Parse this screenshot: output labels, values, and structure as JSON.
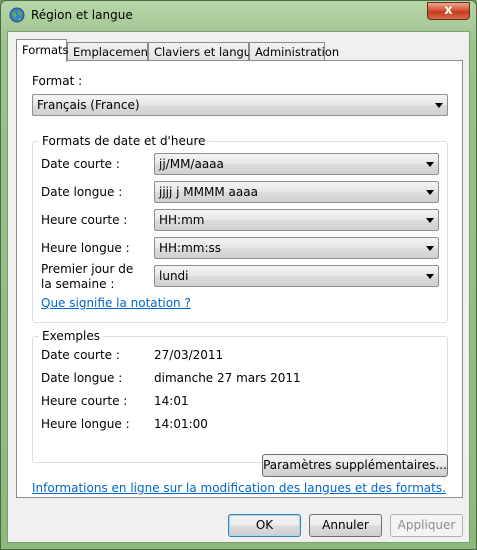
{
  "window": {
    "title": "Région et langue",
    "close_glyph": "x"
  },
  "tabs": [
    {
      "label": "Formats",
      "active": true
    },
    {
      "label": "Emplacement",
      "active": false
    },
    {
      "label": "Claviers et langues",
      "active": false
    },
    {
      "label": "Administration",
      "active": false
    }
  ],
  "format": {
    "label": "Format :",
    "value": "Français (France)"
  },
  "date_time_group": {
    "title": "Formats de date et d'heure",
    "rows": [
      {
        "label": "Date courte :",
        "value": "jj/MM/aaaa"
      },
      {
        "label": "Date longue :",
        "value": "jjjj j MMMM aaaa"
      },
      {
        "label": "Heure courte :",
        "value": "HH:mm"
      },
      {
        "label": "Heure longue :",
        "value": "HH:mm:ss"
      }
    ],
    "first_day_label_line1": "Premier jour de",
    "first_day_label_line2": "la semaine :",
    "first_day_value": "lundi",
    "notation_link": "Que signifie la notation ?"
  },
  "examples_group": {
    "title": "Exemples",
    "rows": [
      {
        "label": "Date courte :",
        "value": "27/03/2011"
      },
      {
        "label": "Date longue :",
        "value": "dimanche 27 mars 2011"
      },
      {
        "label": "Heure courte :",
        "value": "14:01"
      },
      {
        "label": "Heure longue :",
        "value": "14:01:00"
      }
    ]
  },
  "additional_settings_button": "Paramètres supplémentaires...",
  "online_info_link": "Informations en ligne sur la modification des langues et des formats.",
  "buttons": {
    "ok": "OK",
    "cancel": "Annuler",
    "apply": "Appliquer"
  },
  "colors": {
    "accent_link": "#0066cc",
    "window_frame": "#9cc28c"
  }
}
